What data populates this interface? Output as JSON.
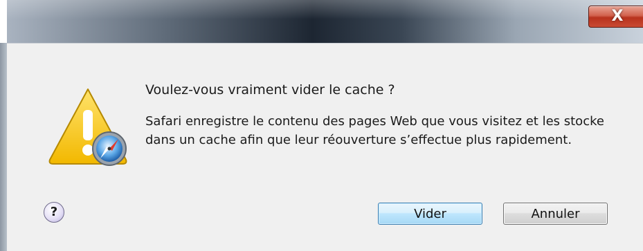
{
  "window": {
    "close_glyph": "X",
    "icon": "close-icon"
  },
  "dialog": {
    "main_instruction": "Voulez-vous vraiment vider le cache ?",
    "content": "Safari enregistre le contenu des pages Web que vous visitez et les stocke dans un cache afin que leur réouverture s’effectue plus rapidement.",
    "warning_icon": "warning-safari-icon",
    "help_glyph": "?"
  },
  "buttons": {
    "confirm_label": "Vider",
    "cancel_label": "Annuler"
  },
  "colors": {
    "dialog_background": "#f0f0f0",
    "default_button_border": "#3c7fb1",
    "close_button": "#c94a33",
    "warning_yellow": "#f5c400"
  }
}
